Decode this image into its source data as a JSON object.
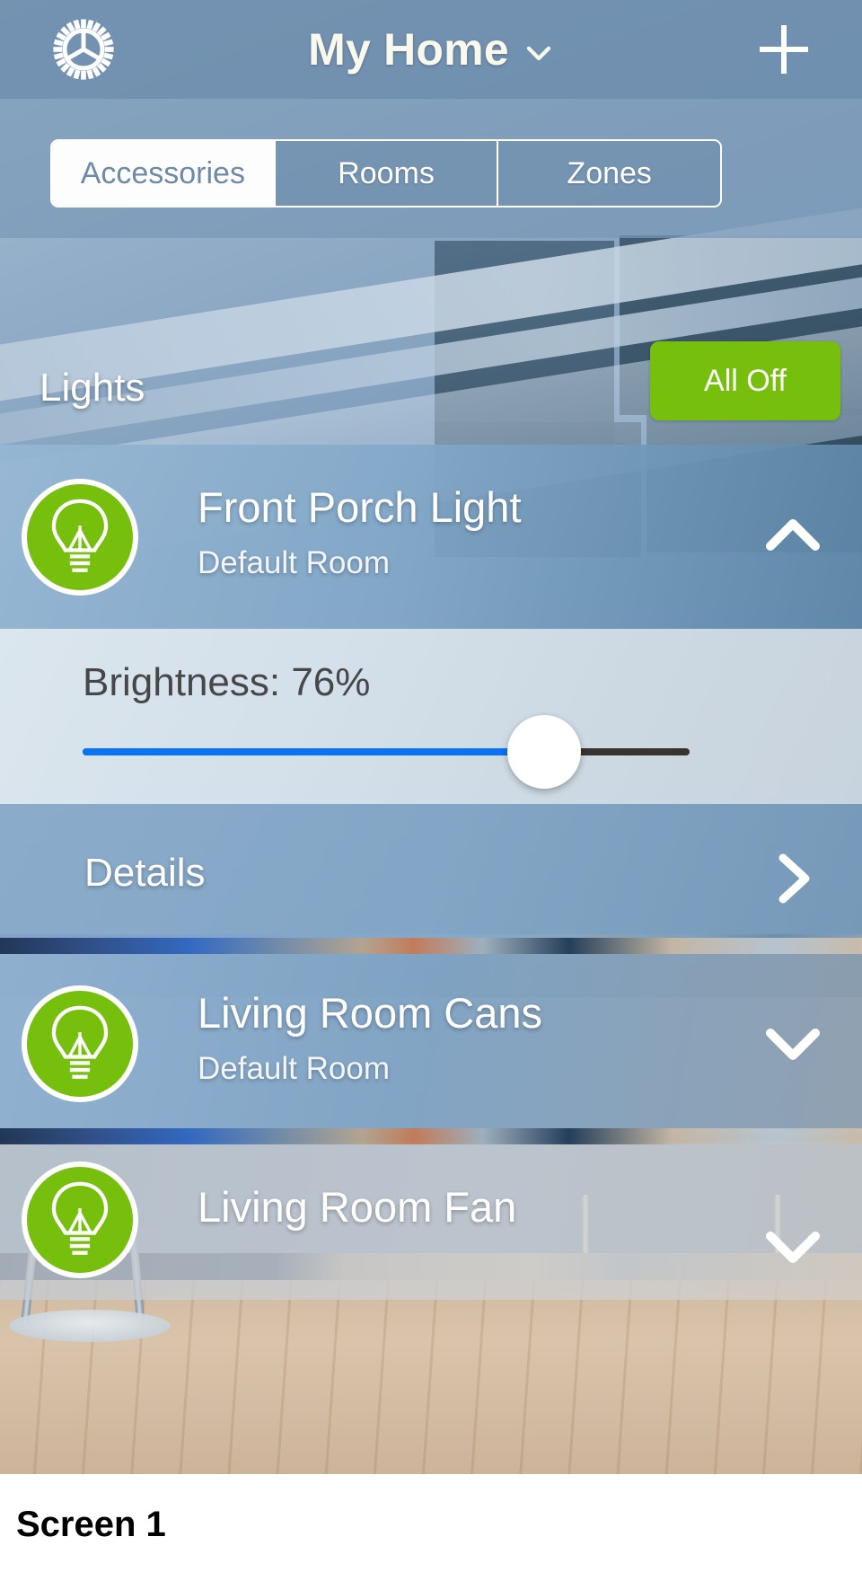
{
  "navbar": {
    "settings_icon": "gear-icon",
    "title": "My Home",
    "title_chevron_icon": "chevron-down-icon",
    "add_icon": "plus-icon"
  },
  "tabs": [
    {
      "label": "Accessories",
      "active": true
    },
    {
      "label": "Rooms",
      "active": false
    },
    {
      "label": "Zones",
      "active": false
    }
  ],
  "group": {
    "title": "Lights",
    "all_off_label": "All Off",
    "all_off_color": "#76c00d"
  },
  "accessories": [
    {
      "name": "Front Porch Light",
      "room": "Default Room",
      "icon": "lightbulb-icon",
      "icon_color": "#76c00d",
      "expanded": true,
      "chevron_icon": "chevron-up-icon"
    },
    {
      "name": "Living Room Cans",
      "room": "Default Room",
      "icon": "lightbulb-icon",
      "icon_color": "#76c00d",
      "expanded": false,
      "chevron_icon": "chevron-down-icon"
    },
    {
      "name": "Living Room Fan",
      "room": "",
      "icon": "lightbulb-icon",
      "icon_color": "#76c00d",
      "expanded": false,
      "chevron_icon": "chevron-down-icon"
    }
  ],
  "brightness": {
    "label": "Brightness: 76%",
    "value": 76,
    "min": 0,
    "max": 100,
    "fill_color": "#0a72f5",
    "track_color": "#3a322c"
  },
  "details": {
    "label": "Details",
    "chevron_icon": "chevron-right-icon"
  },
  "caption": "Screen 1"
}
